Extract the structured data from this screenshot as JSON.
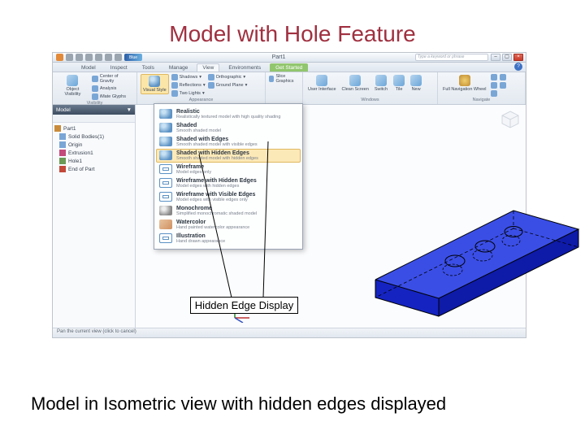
{
  "slide": {
    "title": "Model with Hole Feature",
    "caption": "Model in Isometric view with hidden edges displayed",
    "callout": "Hidden Edge Display"
  },
  "titlebar": {
    "qat_swatch_label": "Blue",
    "doc_title": "Part1",
    "search_placeholder": "Type a keyword or phrase",
    "minimize": "–",
    "maximize": "▢",
    "close": "×"
  },
  "tabs": {
    "items": [
      "Model",
      "Inspect",
      "Tools",
      "Manage",
      "View",
      "Environments",
      "Get Started"
    ],
    "help": "?"
  },
  "ribbon": {
    "panels": [
      {
        "title": "Visibility",
        "big": {
          "label": "Object\nVisibility"
        },
        "rows": [
          "Center of Gravity",
          "Analysis",
          "iMate Glyphs"
        ]
      },
      {
        "title": "Appearance",
        "big": {
          "label": "Visual Style"
        },
        "groups": [
          [
            "Shadows",
            "Reflections",
            "Two Lights"
          ],
          [
            "Orthographic",
            "Ground Plane"
          ]
        ]
      },
      {
        "title": "",
        "items": [
          "Slice Graphics"
        ]
      },
      {
        "title": "Windows",
        "bigs": [
          {
            "label": "User\nInterface"
          },
          {
            "label": "Clean\nScreen"
          },
          {
            "label": "Switch"
          },
          {
            "label": "Tile"
          },
          {
            "label": "New"
          }
        ]
      },
      {
        "title": "Navigate",
        "bigs": [
          {
            "label": "Full Navigation\nWheel"
          }
        ]
      }
    ]
  },
  "browser": {
    "header": "Model",
    "items": [
      {
        "label": "Part1",
        "color": "#c98b3a"
      },
      {
        "label": "Solid Bodies(1)",
        "color": "#7aa6d6"
      },
      {
        "label": "Origin",
        "color": "#7aa6d6"
      },
      {
        "label": "Extrusion1",
        "color": "#c34a7a"
      },
      {
        "label": "Hole1",
        "color": "#6a9a56"
      },
      {
        "label": "End of Part",
        "color": "#c3483a"
      }
    ]
  },
  "visual_styles": {
    "items": [
      {
        "label": "Realistic",
        "desc": "Realistically textured model with high quality shading",
        "ico": "ico-sphere"
      },
      {
        "label": "Shaded",
        "desc": "Smooth shaded model",
        "ico": "ico-sphere"
      },
      {
        "label": "Shaded with Edges",
        "desc": "Smooth shaded model with visible edges",
        "ico": "ico-sphere"
      },
      {
        "label": "Shaded with Hidden Edges",
        "desc": "Smooth shaded model with hidden edges",
        "ico": "ico-sphere",
        "selected": true
      },
      {
        "label": "Wireframe",
        "desc": "Model edges only",
        "ico": "ico-wire"
      },
      {
        "label": "Wireframe with Hidden Edges",
        "desc": "Model edges with hidden edges",
        "ico": "ico-wire"
      },
      {
        "label": "Wireframe with Visible Edges",
        "desc": "Model edges with visible edges only",
        "ico": "ico-wire"
      },
      {
        "label": "Monochrome",
        "desc": "Simplified monochromatic shaded model",
        "ico": "ico-sphere"
      },
      {
        "label": "Watercolor",
        "desc": "Hand painted watercolor appearance",
        "ico": "ico-sphere"
      },
      {
        "label": "Illustration",
        "desc": "Hand drawn appearance",
        "ico": "ico-wire"
      }
    ]
  },
  "statusbar": {
    "hint": "Pan the current view (click to cancel)"
  },
  "colors": {
    "accent": "#1c2fc0",
    "model_top": "#6b7cf0",
    "model_side": "#1520a0"
  }
}
